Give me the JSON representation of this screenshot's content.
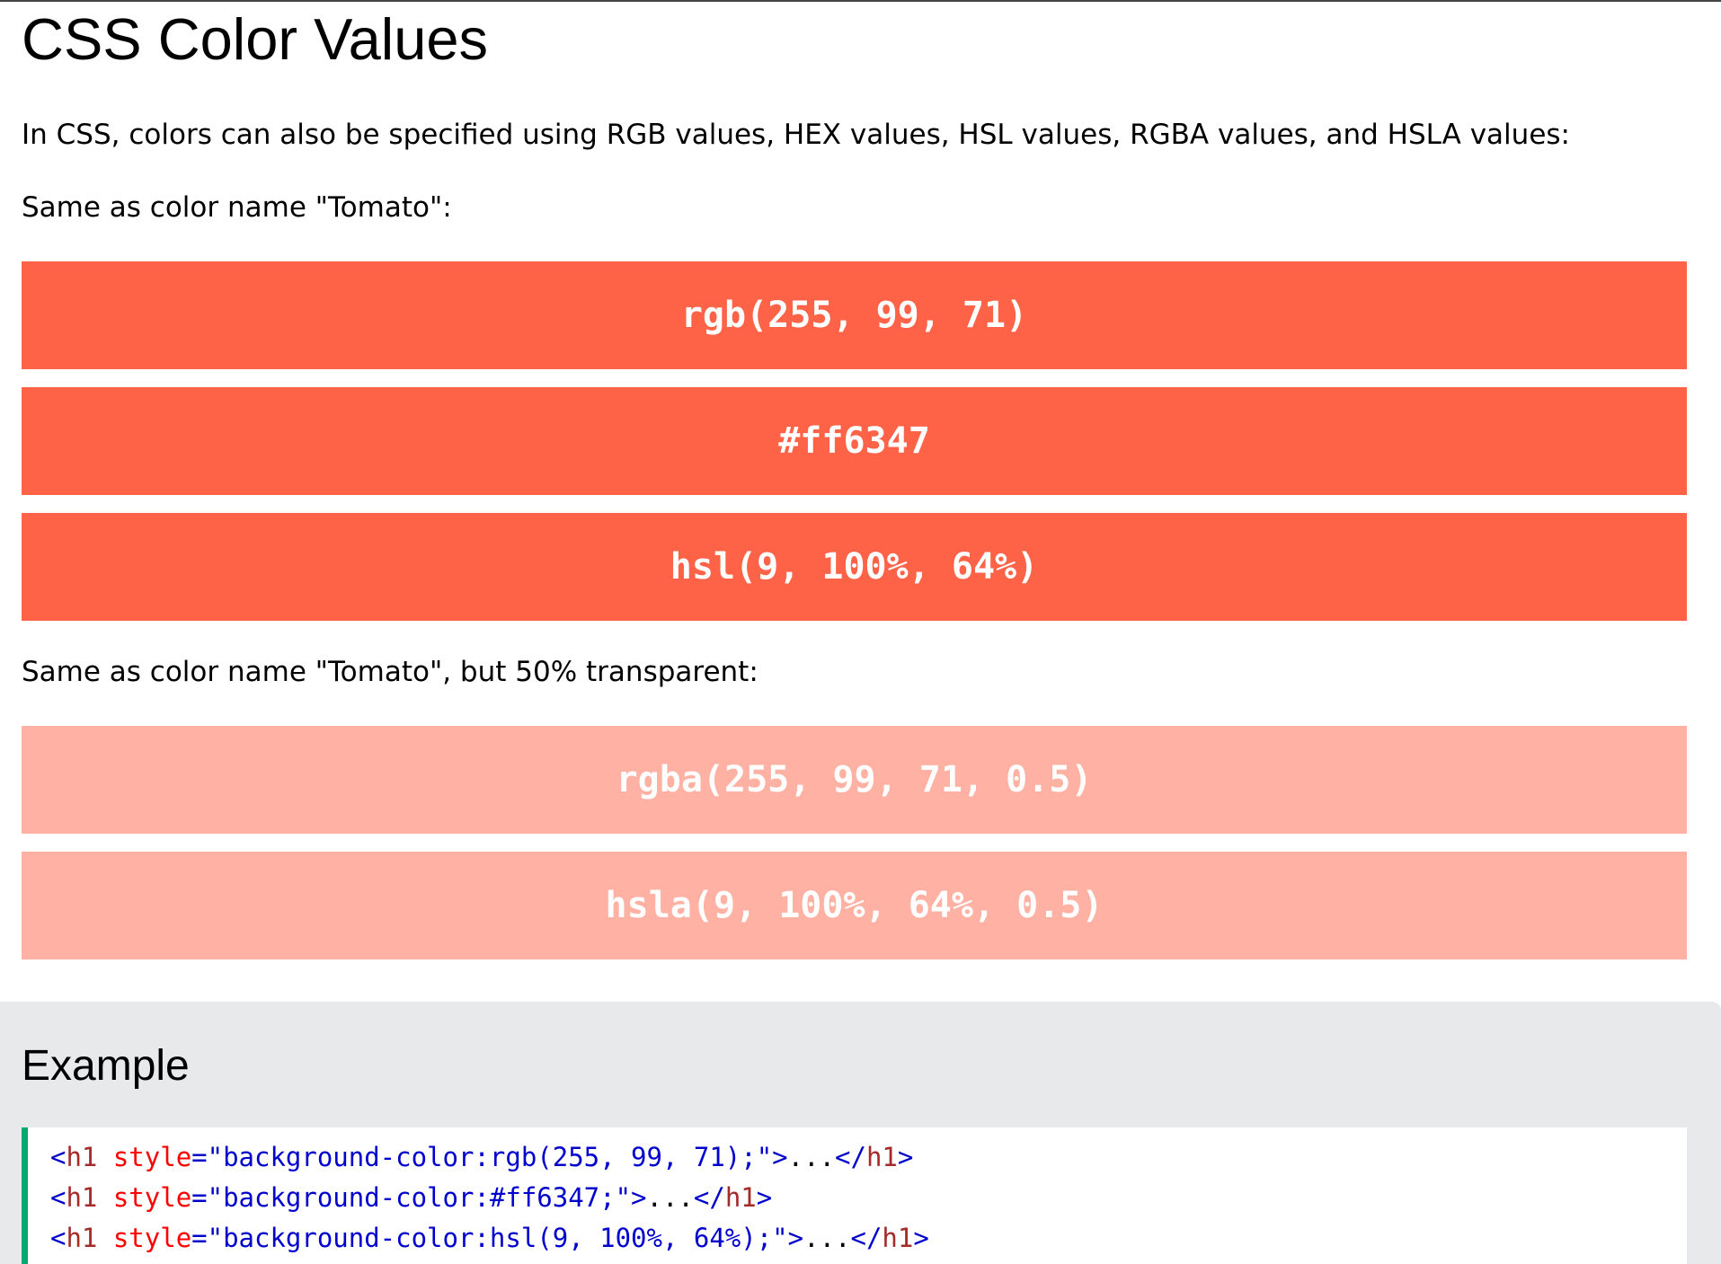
{
  "heading": "CSS Color Values",
  "intro": "In CSS, colors can also be specified using RGB values, HEX values, HSL values, RGBA values, and HSLA values:",
  "solid_caption": "Same as color name \"Tomato\":",
  "solid_swatches": [
    "rgb(255, 99, 71)",
    "#ff6347",
    "hsl(9, 100%, 64%)"
  ],
  "alpha_caption": "Same as color name \"Tomato\", but 50% transparent:",
  "alpha_swatches": [
    "rgba(255, 99, 71, 0.5)",
    "hsla(9, 100%, 64%, 0.5)"
  ],
  "example": {
    "title": "Example",
    "code_lines": [
      {
        "open_bracket": "<",
        "tag": "h1",
        "attr": " style",
        "eq": "=",
        "value": "\"background-color:rgb(255, 99, 71);\"",
        "close_bracket": ">",
        "content": "...",
        "end_open": "</",
        "end_tag": "h1",
        "end_close": ">"
      },
      {
        "open_bracket": "<",
        "tag": "h1",
        "attr": " style",
        "eq": "=",
        "value": "\"background-color:#ff6347;\"",
        "close_bracket": ">",
        "content": "...",
        "end_open": "</",
        "end_tag": "h1",
        "end_close": ">"
      },
      {
        "open_bracket": "<",
        "tag": "h1",
        "attr": " style",
        "eq": "=",
        "value": "\"background-color:hsl(9, 100%, 64%);\"",
        "close_bracket": ">",
        "content": "...",
        "end_open": "</",
        "end_tag": "h1",
        "end_close": ">"
      }
    ]
  },
  "colors": {
    "tomato": "#ff6347",
    "tomato_50": "rgba(255, 99, 71, 0.5)",
    "example_panel_bg": "#e7e9eb",
    "code_border_accent": "#04aa6d"
  }
}
